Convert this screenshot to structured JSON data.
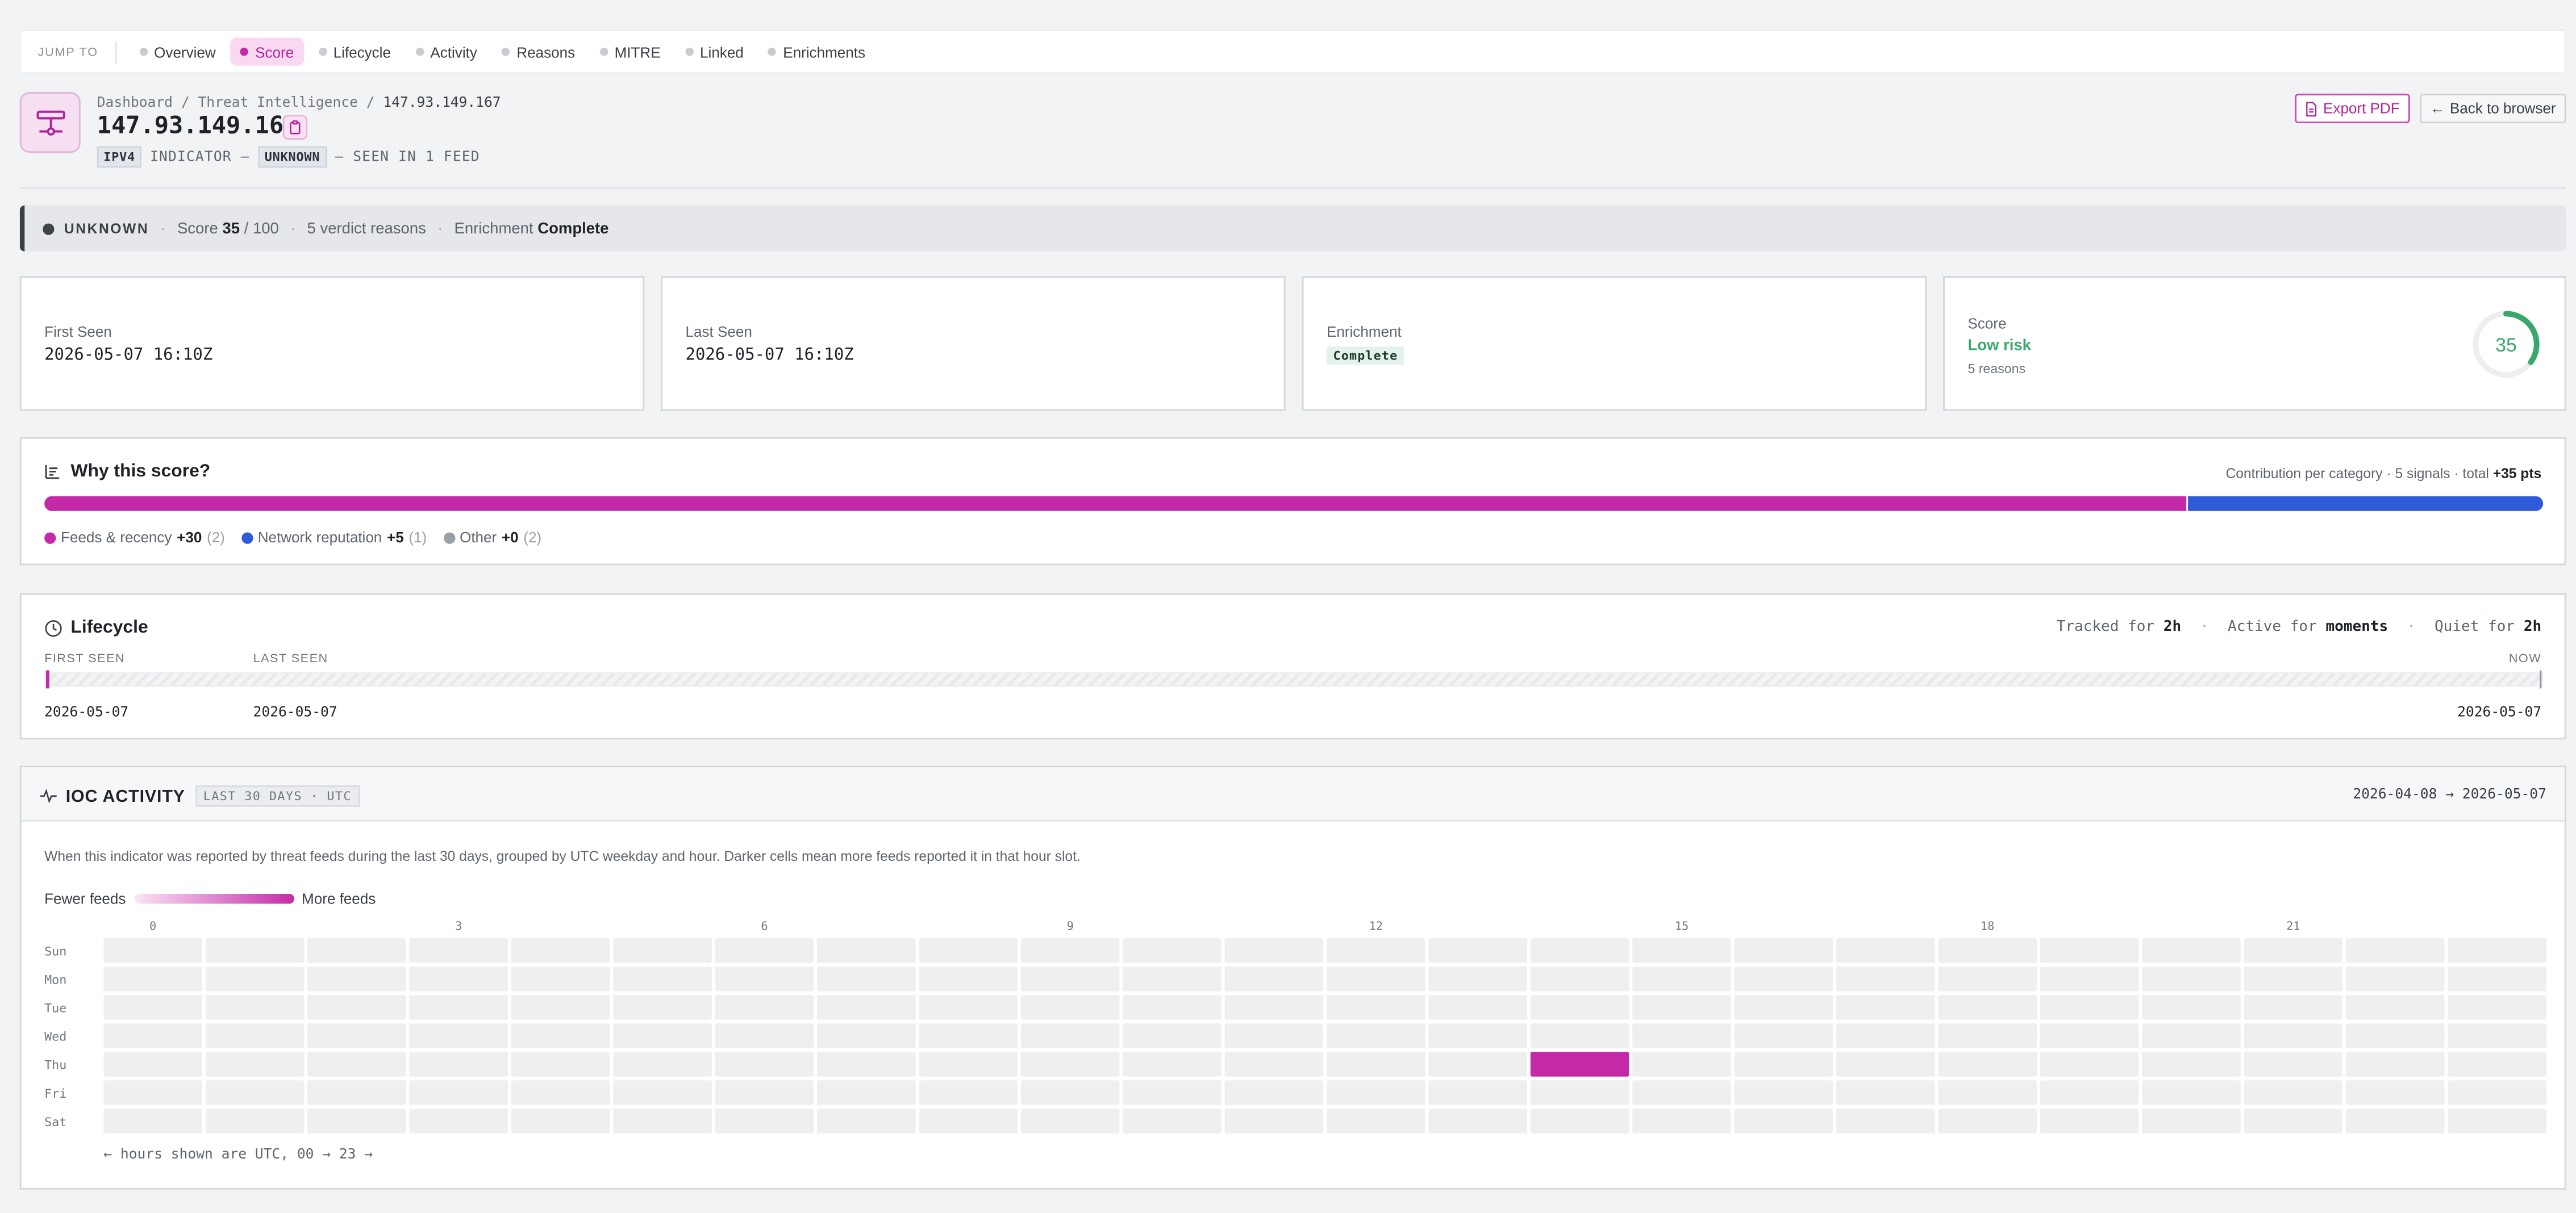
{
  "jumpbar": {
    "label": "JUMP TO",
    "items": [
      "Overview",
      "Score",
      "Lifecycle",
      "Activity",
      "Reasons",
      "MITRE",
      "Linked",
      "Enrichments"
    ],
    "active": "Score"
  },
  "header": {
    "breadcrumb": [
      "Dashboard",
      "Threat Intelligence",
      "147.93.149.167"
    ],
    "title": "147.93.149.167",
    "type_tag": "IPV4",
    "indicator_text": "INDICATOR —",
    "verdict_tag": "UNKNOWN",
    "seen_text": "— SEEN IN 1 FEED",
    "export_label": "Export PDF",
    "back_label": "Back to browser"
  },
  "status": {
    "verdict": "UNKNOWN",
    "score_prefix": "Score",
    "score": "35",
    "score_max": "/ 100",
    "reasons": "5 verdict reasons",
    "enrich_prefix": "Enrichment",
    "enrich_value": "Complete"
  },
  "stats": {
    "first_seen": {
      "label": "First Seen",
      "value": "2026-05-07 16:10Z"
    },
    "last_seen": {
      "label": "Last Seen",
      "value": "2026-05-07 16:10Z"
    },
    "enrichment": {
      "label": "Enrichment",
      "value": "Complete"
    },
    "score": {
      "label": "Score",
      "risk": "Low risk",
      "reasons": "5 reasons",
      "value": 35,
      "max": 100
    }
  },
  "why": {
    "title": "Why this score?",
    "right_prefix": "Contribution per category · 5 signals · total",
    "total": "+35 pts",
    "categories": [
      {
        "name": "Feeds & recency",
        "pts": "+30",
        "count": "(2)",
        "value": 30,
        "color": "#c42aa8"
      },
      {
        "name": "Network reputation",
        "pts": "+5",
        "count": "(1)",
        "value": 5,
        "color": "#2f5bd8"
      },
      {
        "name": "Other",
        "pts": "+0",
        "count": "(2)",
        "value": 0,
        "color": "#9aa0a7"
      }
    ]
  },
  "lifecycle": {
    "title": "Lifecycle",
    "tracked_prefix": "Tracked for",
    "tracked": "2h",
    "active_prefix": "Active for",
    "active": "moments",
    "quiet_prefix": "Quiet for",
    "quiet": "2h",
    "first_label": "FIRST SEEN",
    "last_label": "LAST SEEN",
    "now_label": "NOW",
    "first_date": "2026-05-07",
    "last_date": "2026-05-07",
    "now_date": "2026-05-07"
  },
  "activity": {
    "title": "IOC ACTIVITY",
    "badge": "LAST 30 DAYS · UTC",
    "range": "2026-04-08 → 2026-05-07",
    "description": "When this indicator was reported by threat feeds during the last 30 days, grouped by UTC weekday and hour. Darker cells mean more feeds reported it in that hour slot.",
    "legend_low": "Fewer feeds",
    "legend_high": "More feeds",
    "footer": "← hours shown are UTC, 00 → 23 →",
    "days": [
      "Sun",
      "Mon",
      "Tue",
      "Wed",
      "Thu",
      "Fri",
      "Sat"
    ],
    "hour_ticks": [
      "0",
      "3",
      "6",
      "9",
      "12",
      "15",
      "18",
      "21"
    ],
    "active_cells": [
      {
        "day": "Thu",
        "hour": 14,
        "feeds": 1
      }
    ],
    "colors": {
      "empty": "#efefef",
      "active": "#c42aa8"
    }
  }
}
